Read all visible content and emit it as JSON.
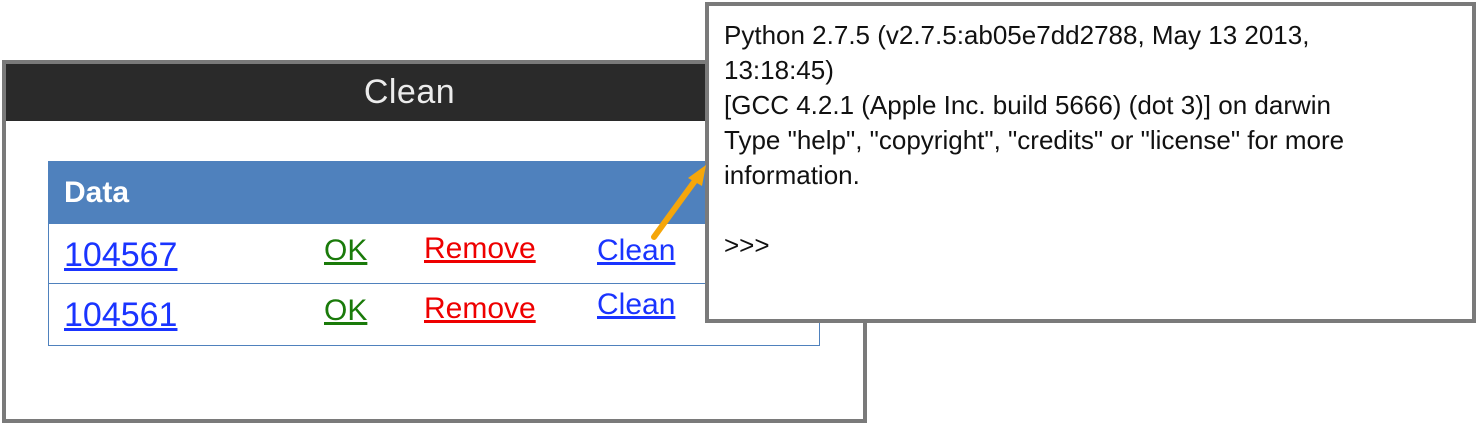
{
  "app_window": {
    "title": "Clean"
  },
  "table": {
    "header": "Data",
    "rows": [
      {
        "id": "104567",
        "ok": "OK",
        "remove": "Remove",
        "clean": "Clean"
      },
      {
        "id": "104561",
        "ok": "OK",
        "remove": "Remove",
        "clean": "Clean"
      }
    ]
  },
  "console": {
    "lines": [
      "Python 2.7.5 (v2.7.5:ab05e7dd2788, May 13 2013,",
      "13:18:45)",
      "[GCC 4.2.1 (Apple Inc. build 5666) (dot 3)] on darwin",
      "Type \"help\", \"copyright\", \"credits\" or \"license\" for more",
      "information."
    ],
    "prompt": ">>>"
  },
  "colors": {
    "title_bar": "#2a2a2a",
    "table_header": "#4f81bd",
    "link_blue": "#1a34ff",
    "ok_green": "#1a7a0a",
    "remove_red": "#ee0000",
    "arrow": "#f5a60a",
    "frame": "#7a7a7a"
  },
  "icons": {
    "arrow": "orange-arrow-icon"
  }
}
